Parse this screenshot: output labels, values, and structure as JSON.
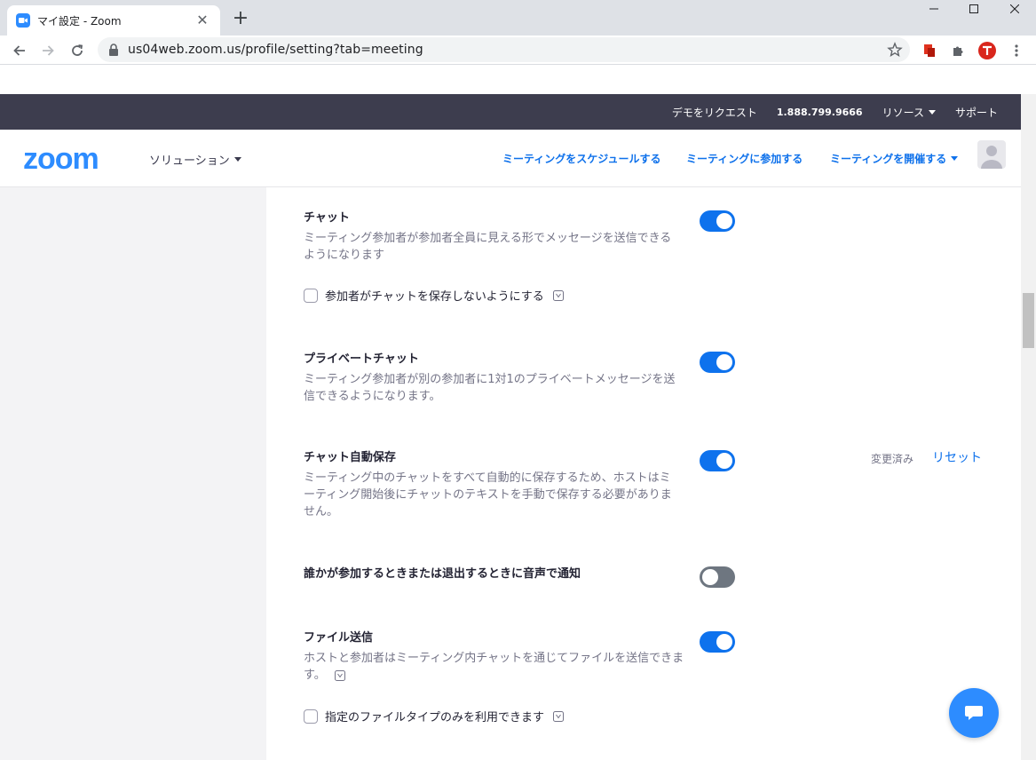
{
  "browser": {
    "tab_title": "マイ設定 - Zoom",
    "url": "us04web.zoom.us/profile/setting?tab=meeting"
  },
  "topbar": {
    "demo": "デモをリクエスト",
    "phone": "1.888.799.9666",
    "resources": "リソース",
    "support": "サポート"
  },
  "header": {
    "logo": "zoom",
    "solutions": "ソリューション",
    "schedule": "ミーティングをスケジュールする",
    "join": "ミーティングに参加する",
    "host": "ミーティングを開催する"
  },
  "settings": {
    "chat": {
      "title": "チャット",
      "desc": "ミーティング参加者が参加者全員に見える形でメッセージを送信できるようになります",
      "enabled": true,
      "option": "参加者がチャットを保存しないようにする"
    },
    "private_chat": {
      "title": "プライベートチャット",
      "desc": "ミーティング参加者が別の参加者に1対1のプライベートメッセージを送信できるようになります。",
      "enabled": true
    },
    "auto_save": {
      "title": "チャット自動保存",
      "desc": "ミーティング中のチャットをすべて自動的に保存するため、ホストはミーティング開始後にチャットのテキストを手動で保存する必要がありません。",
      "enabled": true,
      "modified": "変更済み",
      "reset": "リセット"
    },
    "sound_notify": {
      "title": "誰かが参加するときまたは退出するときに音声で通知",
      "enabled": false
    },
    "file_transfer": {
      "title": "ファイル送信",
      "desc": "ホストと参加者はミーティング内チャットを通じてファイルを送信できます。",
      "enabled": true,
      "option": "指定のファイルタイプのみを利用できます"
    }
  },
  "colors": {
    "accent": "#0e72ed",
    "brand": "#2d8cff",
    "topbar": "#3d3d4e"
  }
}
